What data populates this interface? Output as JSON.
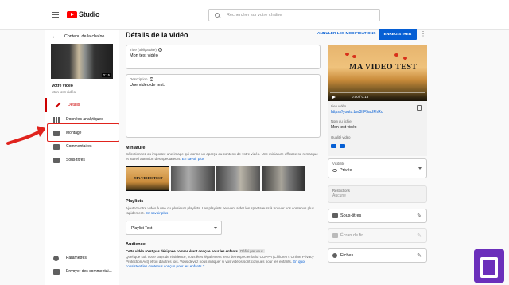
{
  "topbar": {
    "logo_text": "Studio",
    "search_placeholder": "Rechercher sur votre chaîne"
  },
  "sidebar": {
    "back_label": "Contenu de la chaîne",
    "thumb_duration": "0:15",
    "your_video_label": "Votre vidéo",
    "your_video_title": "Mon test vidéo",
    "items": [
      {
        "label": "Détails",
        "icon": "pencil-icon",
        "active": true
      },
      {
        "label": "Données analytiques",
        "icon": "analytics-icon"
      },
      {
        "label": "Montage",
        "icon": "film-icon"
      },
      {
        "label": "Commentaires",
        "icon": "comments-icon"
      },
      {
        "label": "Sous-titres",
        "icon": "subtitles-icon"
      }
    ],
    "bottom_items": [
      {
        "label": "Paramètres",
        "icon": "gear-icon"
      },
      {
        "label": "Envoyer des commentai...",
        "icon": "feedback-icon"
      }
    ]
  },
  "header": {
    "title": "Détails de la vidéo",
    "cancel_label": "ANNULER LES MODIFICATIONS",
    "save_label": "ENREGISTRER"
  },
  "form": {
    "title_label": "Titre (obligatoire)",
    "title_value": "Mon test vidéo",
    "description_label": "Description",
    "description_value": "Une vidéo de test."
  },
  "miniature": {
    "title": "Miniature",
    "text": "Sélectionnez ou importez une image qui donne un aperçu du contenu de votre vidéo. Une miniature efficace se remarque et attire l'attention des spectateurs.",
    "link": "En savoir plus",
    "thumb_text": "MA VIDEO TEST"
  },
  "playlists": {
    "title": "Playlists",
    "text": "Ajoutez votre vidéo à une ou plusieurs playlists. Les playlists peuvent aider les spectateurs à trouver vos contenus plus rapidement.",
    "link": "En savoir plus",
    "value": "Playlist Test"
  },
  "audience": {
    "title": "Audience",
    "line": "Cette vidéo n'est pas désignée comme étant conçue pour les enfants",
    "badge": "Défini par vous",
    "text": "Quel que soit votre pays de résidence, vous êtes légalement tenu de respecter la loi COPPA (Children's Online Privacy Protection Act) et/ou d'autres lois. Vous devez nous indiquer si vos vidéos sont conçues pour les enfants.",
    "link": "En quoi consistent les contenus conçus pour les enfants ?"
  },
  "preview": {
    "title_text": "MA VIDEO TEST",
    "time": "0:00 / 0:15"
  },
  "info": {
    "link_label": "Lien vidéo",
    "link_value": "https://youtu.be/3hF5aUFhRo",
    "file_label": "Nom du fichier",
    "file_value": "Mon test vidéo",
    "quality_label": "Qualité vidéo"
  },
  "visibility": {
    "label": "Visibilité",
    "value": "Privée"
  },
  "restrictions": {
    "label": "Restrictions",
    "value": "Aucune"
  },
  "actions": [
    {
      "label": "Sous-titres",
      "icon": "subtitles-icon",
      "disabled": false
    },
    {
      "label": "Écran de fin",
      "icon": "end-screen-icon",
      "disabled": true
    },
    {
      "label": "Fiches",
      "icon": "cards-icon",
      "disabled": false
    }
  ]
}
